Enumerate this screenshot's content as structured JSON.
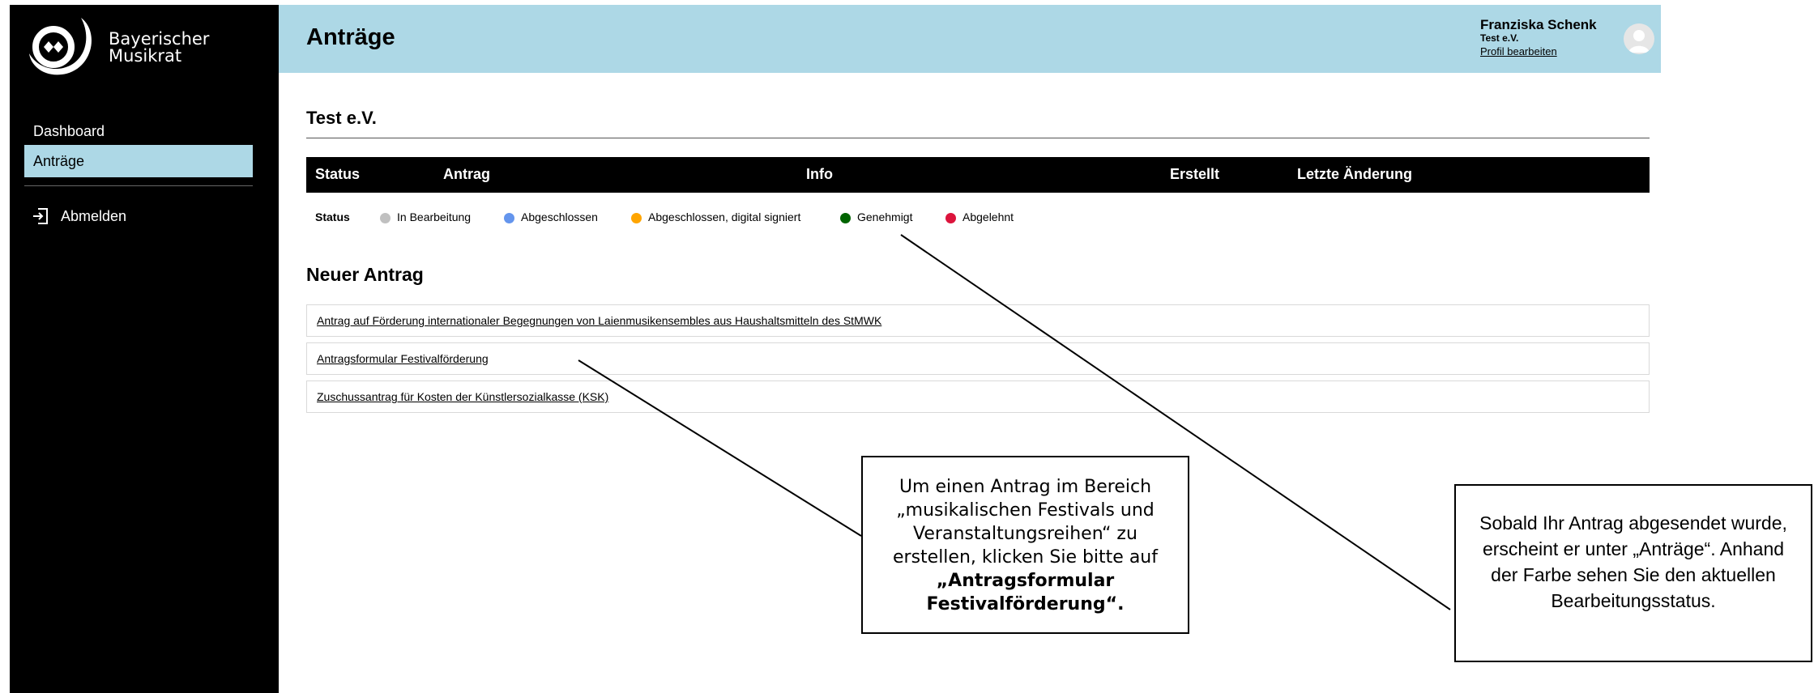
{
  "brand": {
    "name_line1": "Bayerischer",
    "name_line2": "Musikrat"
  },
  "sidebar": {
    "items": [
      {
        "label": "Dashboard"
      },
      {
        "label": "Anträge"
      }
    ],
    "logout_label": "Abmelden"
  },
  "header": {
    "title": "Anträge",
    "user_name": "Franziska Schenk",
    "user_org": "Test e.V.",
    "profile_link": "Profil bearbeiten"
  },
  "main": {
    "org_title": "Test e.V.",
    "table_headers": [
      "Status",
      "Antrag",
      "Info",
      "Erstellt",
      "Letzte Änderung"
    ],
    "legend": {
      "label": "Status",
      "items": [
        {
          "label": "In Bearbeitung",
          "color": "#c0c0c0"
        },
        {
          "label": "Abgeschlossen",
          "color": "#6495ed"
        },
        {
          "label": "Abgeschlossen, digital signiert",
          "color": "#ffa500"
        },
        {
          "label": "Genehmigt",
          "color": "#006400"
        },
        {
          "label": "Abgelehnt",
          "color": "#dc143c"
        }
      ]
    },
    "new_title": "Neuer Antrag",
    "forms": [
      "Antrag auf Förderung internationaler Begegnungen von Laienmusikensembles aus Haushaltsmitteln des StMWK",
      "Antragsformular Festivalförderung",
      "Zuschussantrag für Kosten der Künstlersozialkasse (KSK)"
    ]
  },
  "annotations": {
    "callout1": {
      "text": "Um einen Antrag im Bereich „musikalischen Festivals und Veranstaltungsreihen“ zu erstellen, klicken Sie bitte auf",
      "bold": "„Antragsformular Festivalförderung“."
    },
    "callout2": {
      "text": "Sobald Ihr Antrag abgesendet wurde, erscheint er unter „Anträge“. Anhand der Farbe sehen Sie den aktuellen Bearbeitungsstatus."
    }
  },
  "colors": {
    "sidebar_bg": "#000000",
    "accent": "#add8e6"
  }
}
